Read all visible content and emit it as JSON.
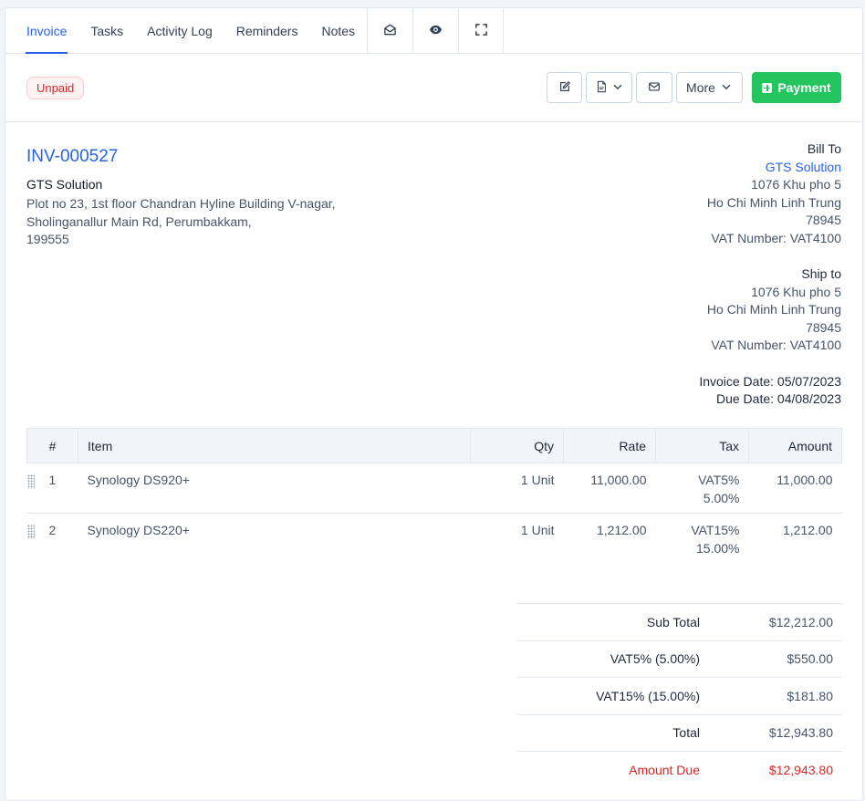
{
  "tabs": [
    {
      "label": "Invoice",
      "active": true
    },
    {
      "label": "Tasks"
    },
    {
      "label": "Activity Log"
    },
    {
      "label": "Reminders"
    },
    {
      "label": "Notes"
    }
  ],
  "tab_icons": [
    "envelope-open-icon",
    "eye-icon",
    "expand-icon"
  ],
  "status": {
    "label": "Unpaid",
    "color": "#dc2626"
  },
  "toolbar": {
    "more_label": "More",
    "payment_label": "Payment",
    "accent": "#22c55e"
  },
  "invoice": {
    "number": "INV-000527",
    "from_name": "GTS Solution",
    "from_address": [
      "Plot no 23, 1st floor Chandran Hyline Building V-nagar,",
      "Sholinganallur Main Rd, Perumbakkam,",
      "199555"
    ]
  },
  "bill_to": {
    "heading": "Bill To",
    "name": "GTS Solution",
    "lines": [
      "1076 Khu pho 5",
      "Ho Chi Minh Linh Trung",
      "78945",
      "VAT Number: VAT4100"
    ]
  },
  "ship_to": {
    "heading": "Ship to",
    "lines": [
      "1076 Khu pho 5",
      "Ho Chi Minh Linh Trung",
      "78945",
      "VAT Number: VAT4100"
    ]
  },
  "dates": {
    "invoice_date_label": "Invoice Date:",
    "invoice_date": "05/07/2023",
    "due_date_label": "Due Date:",
    "due_date": "04/08/2023"
  },
  "table": {
    "headers": [
      "#",
      "Item",
      "Qty",
      "Rate",
      "Tax",
      "Amount"
    ],
    "rows": [
      {
        "num": "1",
        "item": "Synology DS920+",
        "qty": "1 Unit",
        "rate": "11,000.00",
        "tax_name": "VAT5%",
        "tax_rate": "5.00%",
        "amount": "11,000.00"
      },
      {
        "num": "2",
        "item": "Synology DS220+",
        "qty": "1 Unit",
        "rate": "1,212.00",
        "tax_name": "VAT15%",
        "tax_rate": "15.00%",
        "amount": "1,212.00"
      }
    ]
  },
  "totals": [
    {
      "label": "Sub Total",
      "value": "$12,212.00"
    },
    {
      "label": "VAT5% (5.00%)",
      "value": "$550.00"
    },
    {
      "label": "VAT15% (15.00%)",
      "value": "$181.80"
    },
    {
      "label": "Total",
      "value": "$12,943.80"
    },
    {
      "label": "Amount Due",
      "value": "$12,943.80",
      "highlight": true
    }
  ]
}
